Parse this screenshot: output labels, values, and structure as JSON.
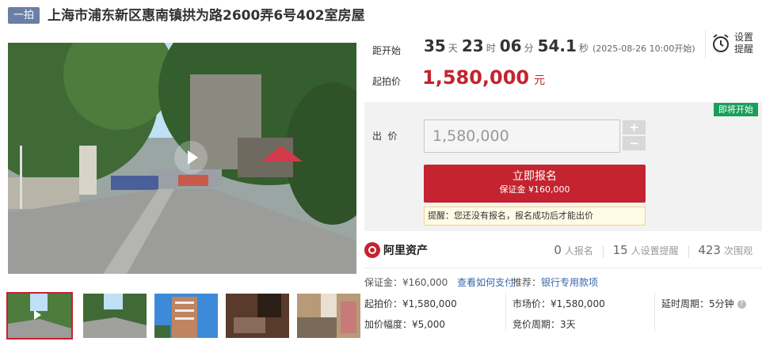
{
  "header": {
    "tag": "一拍",
    "title": "上海市浦东新区惠南镇拱为路2600弄6号402室房屋"
  },
  "countdown": {
    "label": "距开始",
    "days": "35",
    "days_unit": "天",
    "hours": "23",
    "hours_unit": "时",
    "minutes": "06",
    "minutes_unit": "分",
    "seconds": "54.1",
    "seconds_unit": "秒",
    "start_note": "(2025-08-26 10:00开始)"
  },
  "remind": {
    "label": "设置提醒",
    "icon": "alarm-clock-icon"
  },
  "start_price": {
    "label": "起拍价",
    "value": "1,580,000",
    "unit": "元"
  },
  "bid": {
    "badge": "即将开始",
    "label": "出  价",
    "value": "1,580,000",
    "plus": "+",
    "minus": "−",
    "register_label": "立即报名",
    "deposit_label": "保证金 ¥160,000",
    "tip": "提醒：您还没有报名，报名成功后才能出价"
  },
  "platform": {
    "name": "阿里资产"
  },
  "stats": {
    "registered_count": "0",
    "registered_label": "人报名",
    "reminders_count": "15",
    "reminders_label": "人设置提醒",
    "views_count": "423",
    "views_label": "次围观"
  },
  "info": {
    "deposit": "保证金：¥160,000",
    "deposit_link": "查看如何支付",
    "recommend_label": "推荐：",
    "recommend_link": "银行专用款项",
    "start_price": "起拍价：¥1,580,000",
    "market_price": "市场价：¥1,580,000",
    "delay": "延时周期：5分钟",
    "increment": "加价幅度：¥5,000",
    "bid_cycle": "竞价周期：3天"
  },
  "colors": {
    "accent": "#c4232f",
    "tag_bg": "#6b7fa6",
    "badge_green": "#1a9e5a",
    "link": "#3366aa"
  }
}
